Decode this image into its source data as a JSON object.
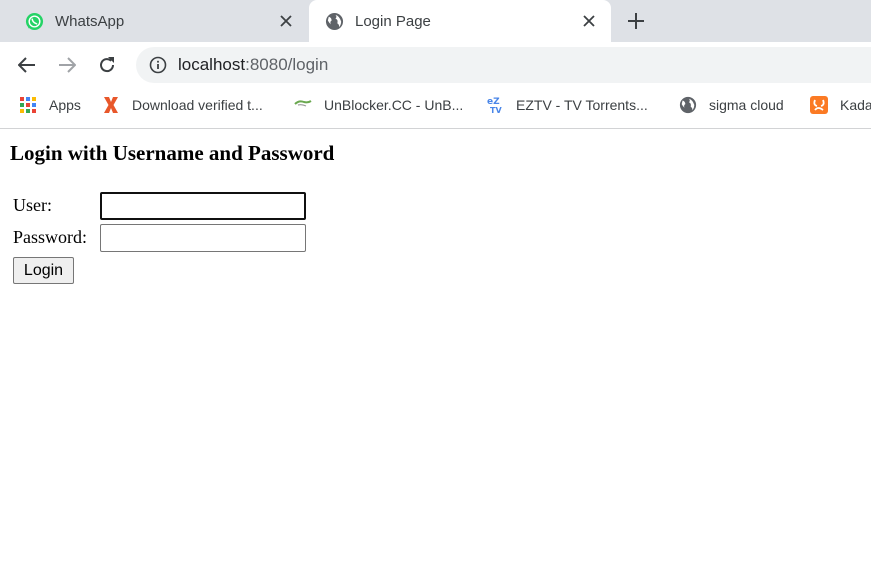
{
  "browser": {
    "tabs": [
      {
        "title": "WhatsApp",
        "icon": "whatsapp-icon",
        "active": false
      },
      {
        "title": "Login Page",
        "icon": "globe-icon",
        "active": true
      }
    ],
    "address": {
      "host": "localhost",
      "rest": ":8080/login"
    },
    "bookmarks": [
      {
        "label": "Apps",
        "icon": "apps-grid-icon"
      },
      {
        "label": "Download verified t...",
        "icon": "x-logo-icon"
      },
      {
        "label": "UnBlocker.CC - UnB...",
        "icon": "unblocker-icon"
      },
      {
        "label": "EZTV - TV Torrents...",
        "icon": "eztv-icon"
      },
      {
        "label": "sigma cloud",
        "icon": "globe-icon"
      },
      {
        "label": "Kada",
        "icon": "xampp-icon"
      }
    ]
  },
  "page": {
    "heading": "Login with Username and Password",
    "user_label": "User:",
    "password_label": "Password:",
    "user_value": "",
    "password_value": "",
    "login_button": "Login"
  },
  "colors": {
    "tabstrip": "#dee1e6",
    "omnibox": "#f1f3f4",
    "whatsapp_green": "#25d366",
    "icon_gray": "#5f6368"
  }
}
